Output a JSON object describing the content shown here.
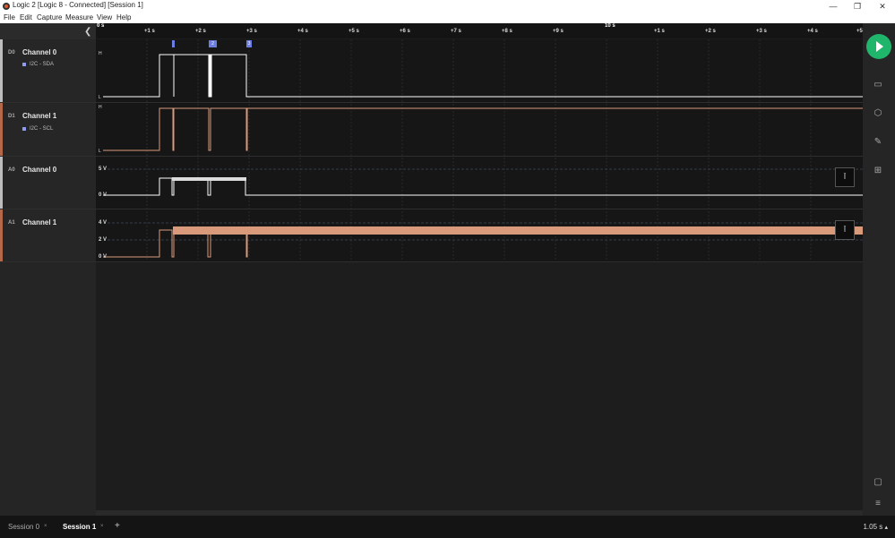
{
  "window": {
    "title": "Logic 2 [Logic 8 - Connected] [Session 1]",
    "minimize": "—",
    "restore": "❐",
    "close": "✕"
  },
  "menu": [
    "File",
    "Edit",
    "Capture",
    "Measure",
    "View",
    "Help"
  ],
  "ruler": {
    "start_label": "0 s",
    "ticks": [
      "+1 s",
      "+2 s",
      "+3 s",
      "+4 s",
      "+5 s",
      "+6 s",
      "+7 s",
      "+8 s",
      "+9 s",
      "+1 s",
      "+2 s",
      "+3 s",
      "+4 s",
      "+5"
    ],
    "major_label": "10 s"
  },
  "markers": [
    "1",
    "2",
    "3"
  ],
  "channels": [
    {
      "id": "D0",
      "name": "Channel 0",
      "analyzer": "I2C - SDA",
      "high": "H",
      "low": "L",
      "color": "#ffffff"
    },
    {
      "id": "D1",
      "name": "Channel 1",
      "analyzer": "I2C - SCL",
      "high": "H",
      "low": "L",
      "color": "#d99a7c"
    },
    {
      "id": "A0",
      "name": "Channel 0",
      "levels": [
        "5 V",
        "0 V"
      ],
      "color": "#ffffff"
    },
    {
      "id": "A1",
      "name": "Channel 1",
      "levels": [
        "4 V",
        "2 V",
        "0 V"
      ],
      "color": "#d99a7c"
    }
  ],
  "tabs": [
    {
      "label": "Session 0",
      "close": "×",
      "active": false
    },
    {
      "label": "Session 1",
      "close": "×",
      "active": true
    }
  ],
  "add_tab": "+",
  "zoom_level": "1.05 s",
  "zoom_caret": "▴",
  "side_button_icon": "Ī",
  "icons": {
    "collapse": "chevron-left-icon",
    "run": "play-icon",
    "device": "device-icon",
    "analyzers": "analyzers-icon",
    "measure": "pencil-icon",
    "extensions": "extensions-icon",
    "chat": "chat-icon",
    "menu": "hamburger-icon"
  },
  "colors": {
    "run_button": "#1fb56b",
    "digital_white": "#ffffff",
    "channel_1": "#d99a7c",
    "analyzer_dot": "#8e9cf0"
  }
}
